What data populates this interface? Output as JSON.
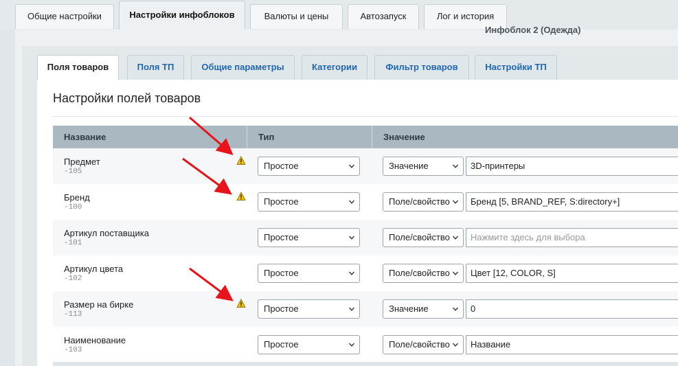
{
  "top_tabs": [
    {
      "label": "Общие настройки",
      "active": false
    },
    {
      "label": "Настройки инфоблоков",
      "active": true
    },
    {
      "label": "Валюты и цены",
      "active": false
    },
    {
      "label": "Автозапуск",
      "active": false
    },
    {
      "label": "Лог и история",
      "active": false
    }
  ],
  "subtitle": "Инфоблок 2 (Одежда)",
  "sub_tabs": [
    {
      "label": "Поля товаров",
      "active": true
    },
    {
      "label": "Поля ТП",
      "active": false
    },
    {
      "label": "Общие параметры",
      "active": false
    },
    {
      "label": "Категории",
      "active": false
    },
    {
      "label": "Фильтр товаров",
      "active": false
    },
    {
      "label": "Настройки ТП",
      "active": false
    }
  ],
  "section_title": "Настройки полей товаров",
  "table": {
    "headers": {
      "name": "Название",
      "type": "Тип",
      "value": "Значение"
    },
    "rows": [
      {
        "name": "Предмет",
        "code": "-105",
        "warning": true,
        "type": "Простое",
        "value_mode": "Значение",
        "value": "3D-принтеры",
        "placeholder": false
      },
      {
        "name": "Бренд",
        "code": "-100",
        "warning": true,
        "type": "Простое",
        "value_mode": "Поле/свойство",
        "value": "Бренд [5, BRAND_REF, S:directory+]",
        "placeholder": false
      },
      {
        "name": "Артикул поставщика",
        "code": "-101",
        "warning": false,
        "type": "Простое",
        "value_mode": "Поле/свойство",
        "value": "Нажмите здесь для выбора",
        "placeholder": true
      },
      {
        "name": "Артикул цвета",
        "code": "-102",
        "warning": false,
        "type": "Простое",
        "value_mode": "Поле/свойство",
        "value": "Цвет [12, COLOR, S]",
        "placeholder": false
      },
      {
        "name": "Размер на бирке",
        "code": "-113",
        "warning": true,
        "type": "Простое",
        "value_mode": "Значение",
        "value": "0",
        "placeholder": false
      },
      {
        "name": "Наименование",
        "code": "-103",
        "warning": false,
        "type": "Простое",
        "value_mode": "Поле/свойство",
        "value": "Название",
        "placeholder": false
      }
    ]
  },
  "icons": {
    "warning": "warning-triangle-icon",
    "chevron": "chevron-down-icon",
    "annotation": "red-arrow"
  },
  "colors": {
    "accent_link": "#2067b0",
    "warning": "#f2c200",
    "arrow": "#e8141c"
  }
}
